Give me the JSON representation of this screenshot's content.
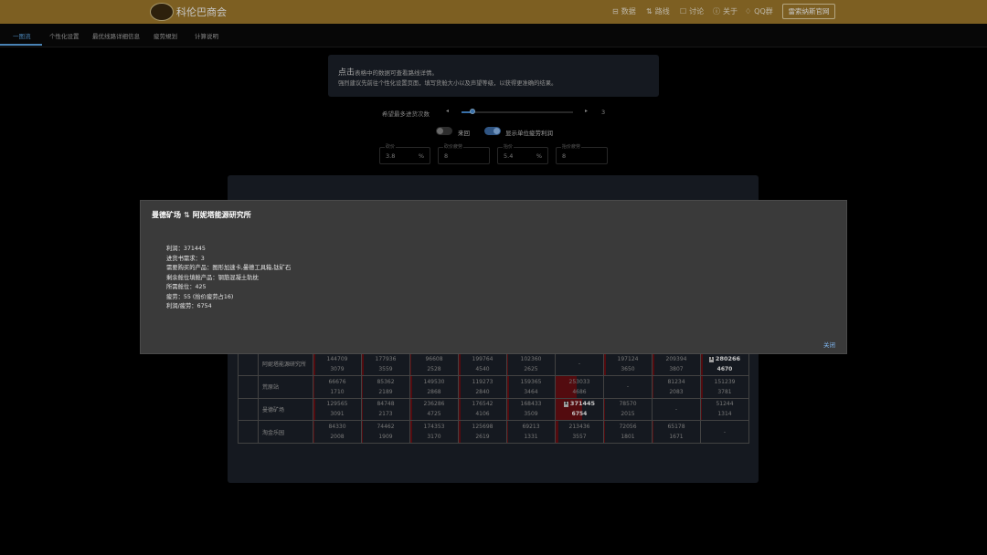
{
  "app": {
    "title": "科伦巴商会",
    "nav": [
      {
        "icon": "database-icon",
        "glyph": "⊟",
        "label": "数据"
      },
      {
        "icon": "route-icon",
        "glyph": "⇅",
        "label": "路线"
      },
      {
        "icon": "chat-icon",
        "glyph": "☐",
        "label": "讨论"
      },
      {
        "icon": "info-icon",
        "glyph": "ⓘ",
        "label": "关于"
      },
      {
        "icon": "bell-icon",
        "glyph": "♢",
        "label": "QQ群"
      }
    ],
    "external_button": "雷索纳斯官网"
  },
  "tabs": [
    "一图流",
    "个性化设置",
    "最优线路详细信息",
    "疲劳規划",
    "计算说明"
  ],
  "info_panel": {
    "line1_big": "点击",
    "line1_rest": "表格中的数据可查看路线详情。",
    "line2": "强烈建议先前往个性化设置页面，填写货舱大小以及声望等级，以获得更准确的结果。"
  },
  "slider": {
    "label": "希望最多进货次数",
    "value": "3",
    "fraction": 0.09
  },
  "toggles": [
    {
      "label": "来回",
      "on": false
    },
    {
      "label": "显示单位疲劳利润",
      "on": true
    }
  ],
  "price_fields": [
    {
      "label": "砍价",
      "value": "3.8",
      "unit": "%"
    },
    {
      "label": "砍价疲劳",
      "value": "8",
      "unit": ""
    },
    {
      "label": "抬价",
      "value": "5.4",
      "unit": "%"
    },
    {
      "label": "抬价疲劳",
      "value": "8",
      "unit": ""
    }
  ],
  "table": {
    "rows": [
      {
        "name": "阿妮塔能源研究所",
        "cells": [
          {
            "v1": "144709",
            "v2": "3079",
            "bar": 0.03
          },
          {
            "v1": "177936",
            "v2": "3559",
            "bar": 0.03
          },
          {
            "v1": "96608",
            "v2": "2528",
            "bar": 0.02
          },
          {
            "v1": "199764",
            "v2": "4540",
            "bar": 0.03
          },
          {
            "v1": "102360",
            "v2": "2625",
            "bar": 0.02
          },
          {
            "v1": "-",
            "v2": "",
            "bar": 0
          },
          {
            "v1": "197124",
            "v2": "3650",
            "bar": 0.03
          },
          {
            "v1": "209394",
            "v2": "3807",
            "bar": 0.03
          },
          {
            "v1": "280266",
            "v2": "4670",
            "bar": 0.03,
            "best": true
          }
        ]
      },
      {
        "name": "荒原站",
        "cells": [
          {
            "v1": "66676",
            "v2": "1710",
            "bar": 0.02
          },
          {
            "v1": "85362",
            "v2": "2189",
            "bar": 0.02
          },
          {
            "v1": "149530",
            "v2": "2868",
            "bar": 0.03
          },
          {
            "v1": "119273",
            "v2": "2840",
            "bar": 0.03
          },
          {
            "v1": "159365",
            "v2": "3464",
            "bar": 0.03
          },
          {
            "v1": "253033",
            "v2": "4686",
            "bar": 0.45
          },
          {
            "v1": "-",
            "v2": "",
            "bar": 0
          },
          {
            "v1": "81234",
            "v2": "2083",
            "bar": 0.02
          },
          {
            "v1": "151239",
            "v2": "3781",
            "bar": 0.03
          }
        ]
      },
      {
        "name": "曼德矿场",
        "cells": [
          {
            "v1": "129565",
            "v2": "3091",
            "bar": 0.03
          },
          {
            "v1": "84748",
            "v2": "2173",
            "bar": 0.02
          },
          {
            "v1": "236286",
            "v2": "4725",
            "bar": 0.03
          },
          {
            "v1": "176542",
            "v2": "4106",
            "bar": 0.03
          },
          {
            "v1": "168433",
            "v2": "3509",
            "bar": 0.03
          },
          {
            "v1": "371445",
            "v2": "6754",
            "bar": 0.55,
            "best": true
          },
          {
            "v1": "78570",
            "v2": "2015",
            "bar": 0.02
          },
          {
            "v1": "-",
            "v2": "",
            "bar": 0
          },
          {
            "v1": "51244",
            "v2": "1314",
            "bar": 0.02
          }
        ]
      },
      {
        "name": "淘金乐园",
        "cells": [
          {
            "v1": "84330",
            "v2": "2008",
            "bar": 0.02
          },
          {
            "v1": "74462",
            "v2": "1909",
            "bar": 0.02
          },
          {
            "v1": "174353",
            "v2": "3170",
            "bar": 0.03
          },
          {
            "v1": "125698",
            "v2": "2619",
            "bar": 0.03
          },
          {
            "v1": "69213",
            "v2": "1331",
            "bar": 0.02
          },
          {
            "v1": "213436",
            "v2": "3557",
            "bar": 0.05
          },
          {
            "v1": "72056",
            "v2": "1801",
            "bar": 0.02
          },
          {
            "v1": "65178",
            "v2": "1671",
            "bar": 0.02
          },
          {
            "v1": "-",
            "v2": "",
            "bar": 0
          }
        ]
      }
    ]
  },
  "modal": {
    "from": "曼德矿场",
    "arrow": "⇅",
    "to": "阿妮塔能源研究所",
    "lines": [
      "利润：371445",
      "进货书需求：3",
      "需要购买的产品：图形加速卡,曼德工具箱,钛矿石",
      "剩余舱位填舱产品：钢筋混凝土轨枕",
      "所需舱位：425",
      "疲劳：55 (抬价疲劳占16)",
      "利润/疲劳：6754"
    ],
    "close_label": "关闭"
  },
  "colors": {
    "topbar": "#a07a2c",
    "accent": "#5ea8e8",
    "heat": "#6b0f14"
  }
}
